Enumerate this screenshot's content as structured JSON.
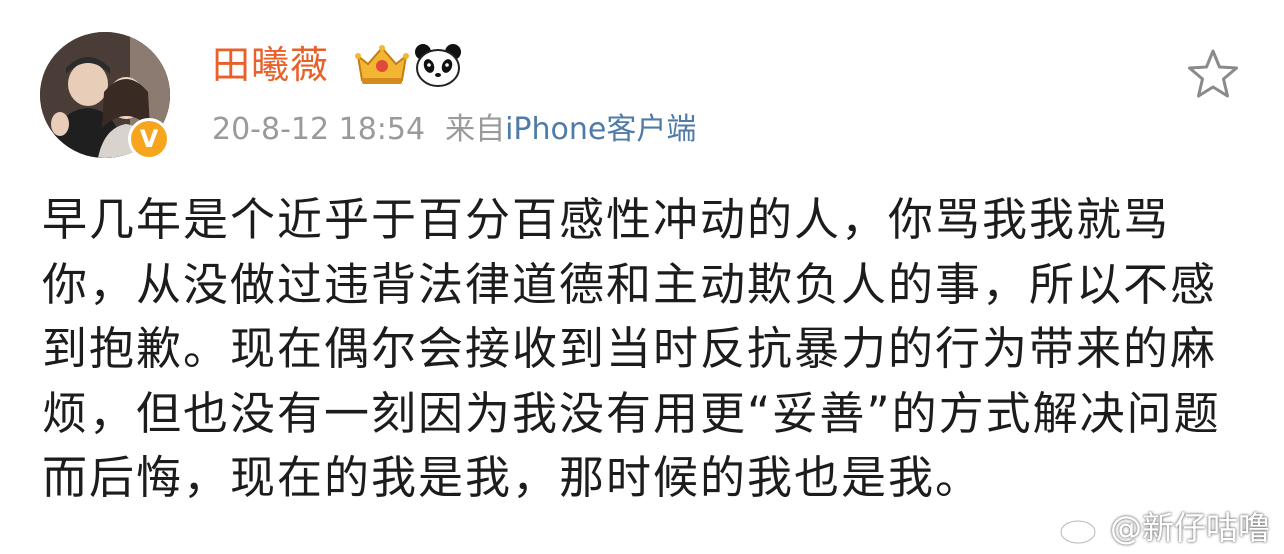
{
  "post": {
    "username": "田曦薇",
    "time": "20-8-12 18:54",
    "source_prefix": "来自",
    "source_link": "iPhone客户端",
    "body": "早几年是个近乎于百分百感性冲动的人，你骂我我就骂你，从没做过违背法律道德和主动欺负人的事，所以不感到抱歉。现在偶尔会接收到当时反抗暴力的行为带来的麻烦，但也没有一刻因为我没有用更“妥善”的方式解决问题而后悔，现在的我是我，那时候的我也是我。",
    "verified_badge": "V"
  },
  "watermark": {
    "handle": "@新仔咕噜"
  },
  "icons": {
    "favorite": "star-icon",
    "crown": "crown-badge-icon",
    "panda": "panda-badge-icon",
    "weibo": "weibo-logo-icon"
  },
  "colors": {
    "username": "#e8612b",
    "meta": "#9a9a9a",
    "source_link": "#4f7ba8",
    "body_text": "#1c1c1c",
    "verified": "#f7a51c"
  }
}
